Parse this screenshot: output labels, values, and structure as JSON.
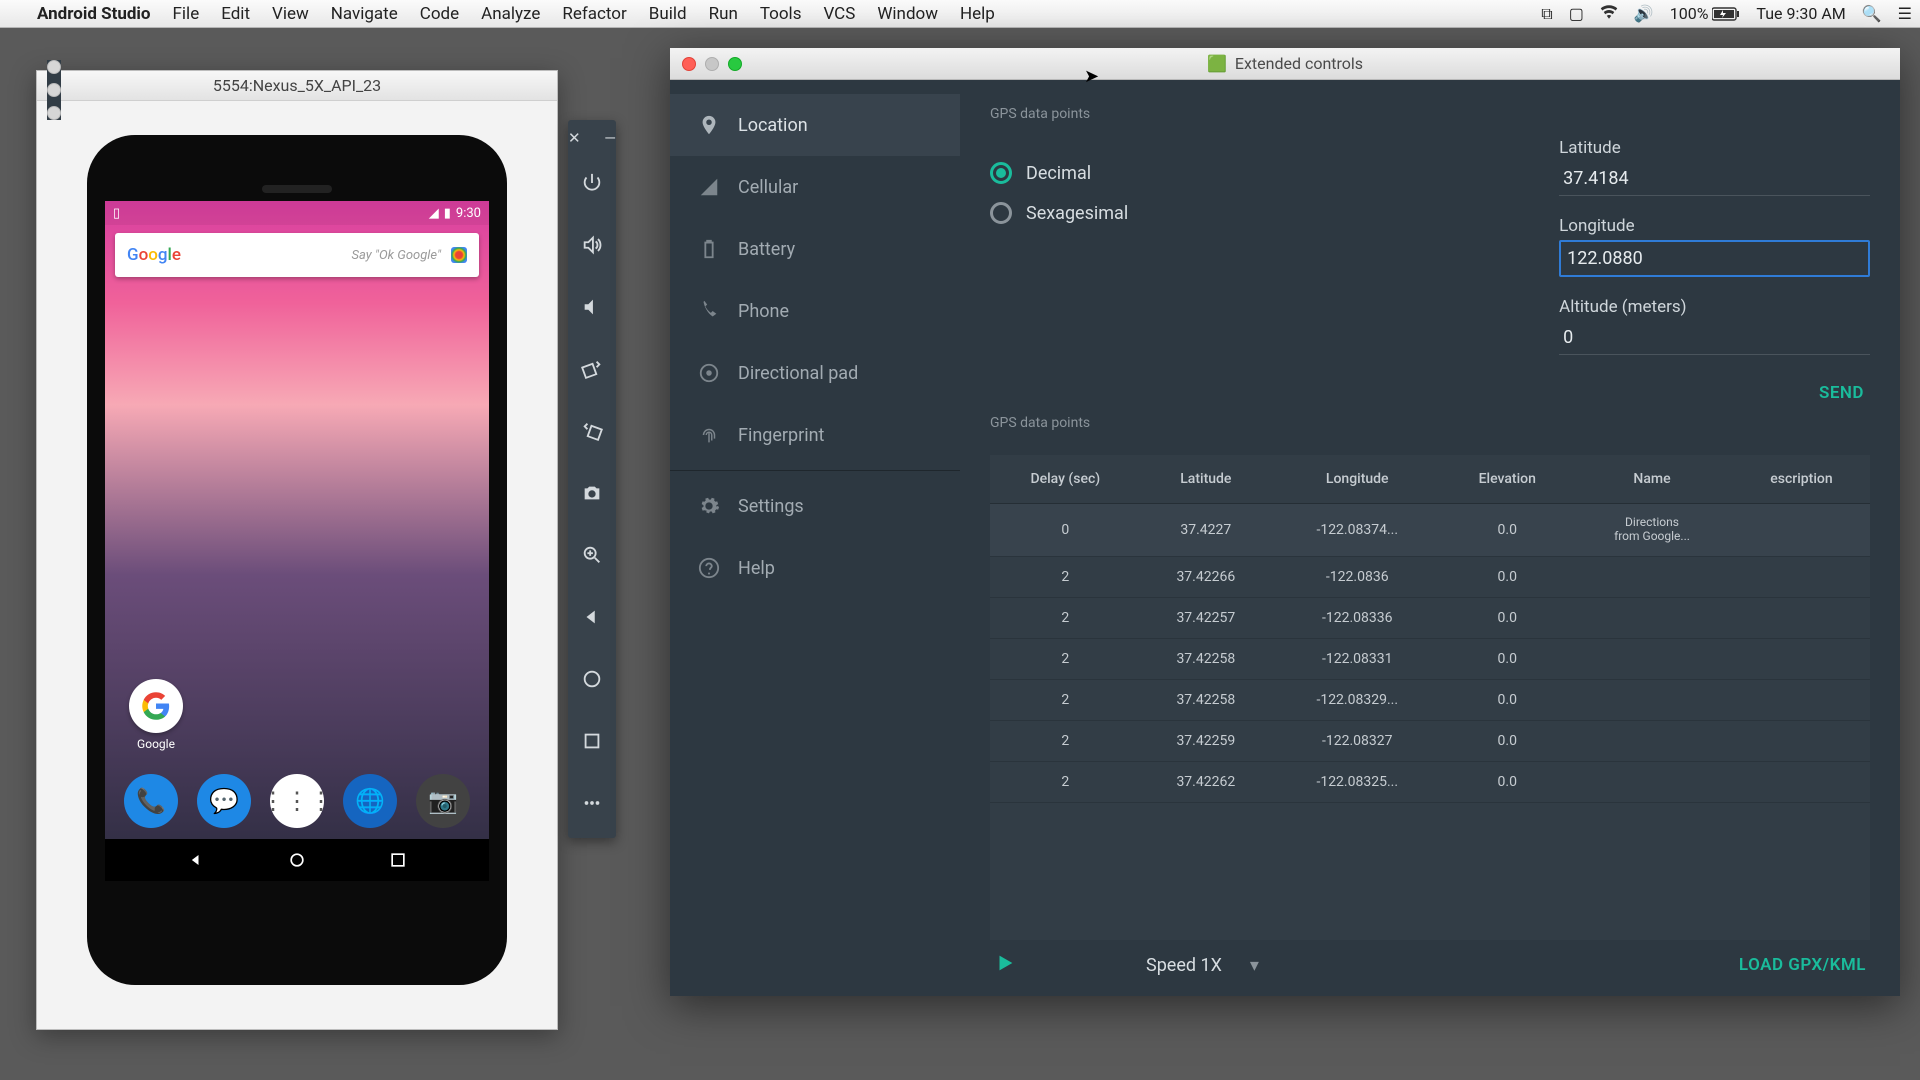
{
  "menubar": {
    "app": "Android Studio",
    "items": [
      "File",
      "Edit",
      "View",
      "Navigate",
      "Code",
      "Analyze",
      "Refactor",
      "Build",
      "Run",
      "Tools",
      "VCS",
      "Window",
      "Help"
    ],
    "battery": "100%",
    "clock": "Tue 9:30 AM"
  },
  "emulator": {
    "title": "5554:Nexus_5X_API_23",
    "statusbar": {
      "time": "9:30"
    },
    "search_placeholder": "Say \"Ok Google\"",
    "google_label": "Google"
  },
  "extended": {
    "title": "Extended controls",
    "nav": [
      {
        "label": "Location",
        "icon": "location"
      },
      {
        "label": "Cellular",
        "icon": "cellular"
      },
      {
        "label": "Battery",
        "icon": "battery"
      },
      {
        "label": "Phone",
        "icon": "phone"
      },
      {
        "label": "Directional pad",
        "icon": "dpad"
      },
      {
        "label": "Fingerprint",
        "icon": "fingerprint"
      },
      {
        "label": "Settings",
        "icon": "settings"
      },
      {
        "label": "Help",
        "icon": "help"
      }
    ],
    "gps": {
      "section1": "GPS data points",
      "format": {
        "decimal": "Decimal",
        "sexagesimal": "Sexagesimal",
        "selected": "decimal"
      },
      "lat_label": "Latitude",
      "lat_value": "37.4184",
      "lon_label": "Longitude",
      "lon_value": "122.0880",
      "alt_label": "Altitude (meters)",
      "alt_value": "0",
      "send": "SEND",
      "section2": "GPS data points",
      "headers": [
        "Delay (sec)",
        "Latitude",
        "Longitude",
        "Elevation",
        "Name",
        "escription"
      ],
      "rows": [
        {
          "delay": "0",
          "lat": "37.4227",
          "lon": "-122.08374...",
          "elev": "0.0",
          "name": "Directions from Google...",
          "desc": ""
        },
        {
          "delay": "2",
          "lat": "37.42266",
          "lon": "-122.0836",
          "elev": "0.0",
          "name": "",
          "desc": ""
        },
        {
          "delay": "2",
          "lat": "37.42257",
          "lon": "-122.08336",
          "elev": "0.0",
          "name": "",
          "desc": ""
        },
        {
          "delay": "2",
          "lat": "37.42258",
          "lon": "-122.08331",
          "elev": "0.0",
          "name": "",
          "desc": ""
        },
        {
          "delay": "2",
          "lat": "37.42258",
          "lon": "-122.08329...",
          "elev": "0.0",
          "name": "",
          "desc": ""
        },
        {
          "delay": "2",
          "lat": "37.42259",
          "lon": "-122.08327",
          "elev": "0.0",
          "name": "",
          "desc": ""
        },
        {
          "delay": "2",
          "lat": "37.42262",
          "lon": "-122.08325...",
          "elev": "0.0",
          "name": "",
          "desc": ""
        }
      ],
      "speed": "Speed 1X",
      "load": "LOAD GPX/KML"
    }
  }
}
